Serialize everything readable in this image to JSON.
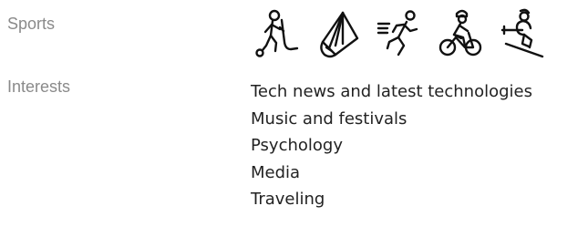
{
  "sections": {
    "sports": {
      "label": "Sports",
      "icons": [
        "hockey-player-icon",
        "badminton-shuttlecock-icon",
        "runner-icon",
        "cyclist-icon",
        "skier-icon"
      ]
    },
    "interests": {
      "label": "Interests",
      "items": [
        "Tech news and latest technologies",
        "Music and festivals",
        "Psychology",
        "Media",
        "Traveling"
      ]
    }
  },
  "colors": {
    "label": "#8a8a8a",
    "text": "#222222",
    "icon_stroke": "#111111"
  }
}
